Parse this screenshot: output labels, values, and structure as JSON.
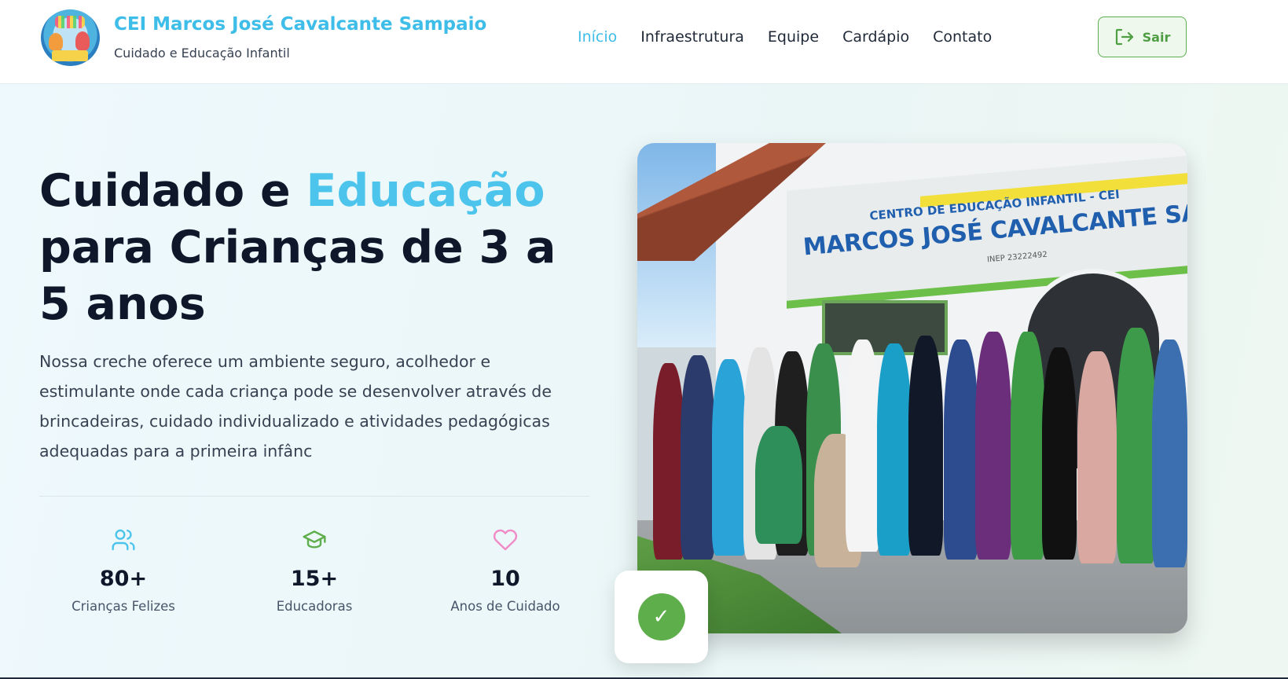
{
  "header": {
    "brand_title": "CEI Marcos José Cavalcante Sampaio",
    "brand_subtitle": "Cuidado e Educação Infantil",
    "logo_icon": "school-logo-kids-reading",
    "nav": [
      {
        "label": "Início",
        "active": true
      },
      {
        "label": "Infraestrutura",
        "active": false
      },
      {
        "label": "Equipe",
        "active": false
      },
      {
        "label": "Cardápio",
        "active": false
      },
      {
        "label": "Contato",
        "active": false
      }
    ],
    "logout_label": "Sair",
    "logout_icon": "logout-icon"
  },
  "hero": {
    "title_part1": "Cuidado e ",
    "title_accent": "Educação",
    "title_part2": "para Crianças de 3 a 5 anos",
    "description": "Nossa creche oferece um ambiente seguro, acolhedor e estimulante onde cada criança pode se desenvolver através de brincadeiras, cuidado individualizado e atividades pedagógicas adequadas para a primeira infânc",
    "stats": [
      {
        "icon": "users-icon",
        "value": "80+",
        "label": "Crianças Felizes",
        "color": "#4cc4ec"
      },
      {
        "icon": "graduation-cap-icon",
        "value": "15+",
        "label": "Educadoras",
        "color": "#5fae4c"
      },
      {
        "icon": "heart-icon",
        "value": "10",
        "label": "Anos de Cuidado",
        "color": "#f08bc7"
      }
    ],
    "photo": {
      "sign_small": "CENTRO DE EDUCAÇÃO INFANTIL - CEI",
      "sign_big": "MARCOS JOSÉ CAVALCANTE SAMPAI",
      "sign_inep": "INEP 23222492"
    },
    "badge_icon": "check-icon",
    "badge_symbol": "✓"
  },
  "colors": {
    "accent": "#3ebde8",
    "green": "#5fae4c",
    "text": "#0f172a"
  }
}
